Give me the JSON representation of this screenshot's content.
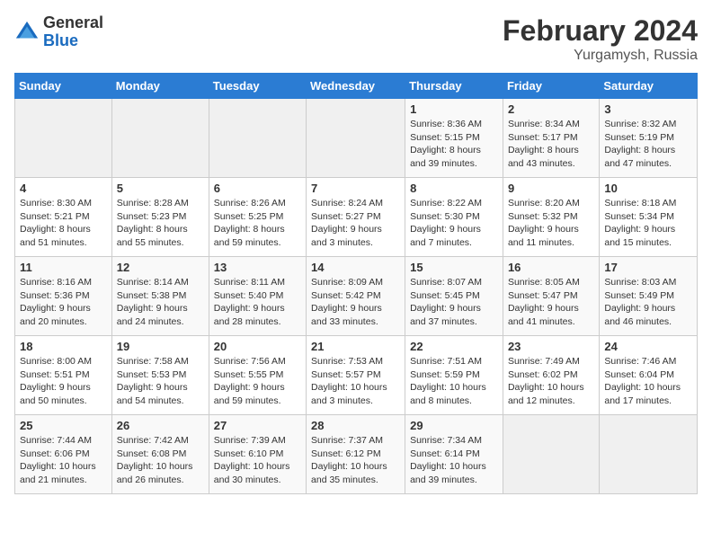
{
  "header": {
    "logo_general": "General",
    "logo_blue": "Blue",
    "month_year": "February 2024",
    "location": "Yurgamysh, Russia"
  },
  "weekdays": [
    "Sunday",
    "Monday",
    "Tuesday",
    "Wednesday",
    "Thursday",
    "Friday",
    "Saturday"
  ],
  "weeks": [
    [
      {
        "day": "",
        "info": ""
      },
      {
        "day": "",
        "info": ""
      },
      {
        "day": "",
        "info": ""
      },
      {
        "day": "",
        "info": ""
      },
      {
        "day": "1",
        "info": "Sunrise: 8:36 AM\nSunset: 5:15 PM\nDaylight: 8 hours\nand 39 minutes."
      },
      {
        "day": "2",
        "info": "Sunrise: 8:34 AM\nSunset: 5:17 PM\nDaylight: 8 hours\nand 43 minutes."
      },
      {
        "day": "3",
        "info": "Sunrise: 8:32 AM\nSunset: 5:19 PM\nDaylight: 8 hours\nand 47 minutes."
      }
    ],
    [
      {
        "day": "4",
        "info": "Sunrise: 8:30 AM\nSunset: 5:21 PM\nDaylight: 8 hours\nand 51 minutes."
      },
      {
        "day": "5",
        "info": "Sunrise: 8:28 AM\nSunset: 5:23 PM\nDaylight: 8 hours\nand 55 minutes."
      },
      {
        "day": "6",
        "info": "Sunrise: 8:26 AM\nSunset: 5:25 PM\nDaylight: 8 hours\nand 59 minutes."
      },
      {
        "day": "7",
        "info": "Sunrise: 8:24 AM\nSunset: 5:27 PM\nDaylight: 9 hours\nand 3 minutes."
      },
      {
        "day": "8",
        "info": "Sunrise: 8:22 AM\nSunset: 5:30 PM\nDaylight: 9 hours\nand 7 minutes."
      },
      {
        "day": "9",
        "info": "Sunrise: 8:20 AM\nSunset: 5:32 PM\nDaylight: 9 hours\nand 11 minutes."
      },
      {
        "day": "10",
        "info": "Sunrise: 8:18 AM\nSunset: 5:34 PM\nDaylight: 9 hours\nand 15 minutes."
      }
    ],
    [
      {
        "day": "11",
        "info": "Sunrise: 8:16 AM\nSunset: 5:36 PM\nDaylight: 9 hours\nand 20 minutes."
      },
      {
        "day": "12",
        "info": "Sunrise: 8:14 AM\nSunset: 5:38 PM\nDaylight: 9 hours\nand 24 minutes."
      },
      {
        "day": "13",
        "info": "Sunrise: 8:11 AM\nSunset: 5:40 PM\nDaylight: 9 hours\nand 28 minutes."
      },
      {
        "day": "14",
        "info": "Sunrise: 8:09 AM\nSunset: 5:42 PM\nDaylight: 9 hours\nand 33 minutes."
      },
      {
        "day": "15",
        "info": "Sunrise: 8:07 AM\nSunset: 5:45 PM\nDaylight: 9 hours\nand 37 minutes."
      },
      {
        "day": "16",
        "info": "Sunrise: 8:05 AM\nSunset: 5:47 PM\nDaylight: 9 hours\nand 41 minutes."
      },
      {
        "day": "17",
        "info": "Sunrise: 8:03 AM\nSunset: 5:49 PM\nDaylight: 9 hours\nand 46 minutes."
      }
    ],
    [
      {
        "day": "18",
        "info": "Sunrise: 8:00 AM\nSunset: 5:51 PM\nDaylight: 9 hours\nand 50 minutes."
      },
      {
        "day": "19",
        "info": "Sunrise: 7:58 AM\nSunset: 5:53 PM\nDaylight: 9 hours\nand 54 minutes."
      },
      {
        "day": "20",
        "info": "Sunrise: 7:56 AM\nSunset: 5:55 PM\nDaylight: 9 hours\nand 59 minutes."
      },
      {
        "day": "21",
        "info": "Sunrise: 7:53 AM\nSunset: 5:57 PM\nDaylight: 10 hours\nand 3 minutes."
      },
      {
        "day": "22",
        "info": "Sunrise: 7:51 AM\nSunset: 5:59 PM\nDaylight: 10 hours\nand 8 minutes."
      },
      {
        "day": "23",
        "info": "Sunrise: 7:49 AM\nSunset: 6:02 PM\nDaylight: 10 hours\nand 12 minutes."
      },
      {
        "day": "24",
        "info": "Sunrise: 7:46 AM\nSunset: 6:04 PM\nDaylight: 10 hours\nand 17 minutes."
      }
    ],
    [
      {
        "day": "25",
        "info": "Sunrise: 7:44 AM\nSunset: 6:06 PM\nDaylight: 10 hours\nand 21 minutes."
      },
      {
        "day": "26",
        "info": "Sunrise: 7:42 AM\nSunset: 6:08 PM\nDaylight: 10 hours\nand 26 minutes."
      },
      {
        "day": "27",
        "info": "Sunrise: 7:39 AM\nSunset: 6:10 PM\nDaylight: 10 hours\nand 30 minutes."
      },
      {
        "day": "28",
        "info": "Sunrise: 7:37 AM\nSunset: 6:12 PM\nDaylight: 10 hours\nand 35 minutes."
      },
      {
        "day": "29",
        "info": "Sunrise: 7:34 AM\nSunset: 6:14 PM\nDaylight: 10 hours\nand 39 minutes."
      },
      {
        "day": "",
        "info": ""
      },
      {
        "day": "",
        "info": ""
      }
    ]
  ]
}
